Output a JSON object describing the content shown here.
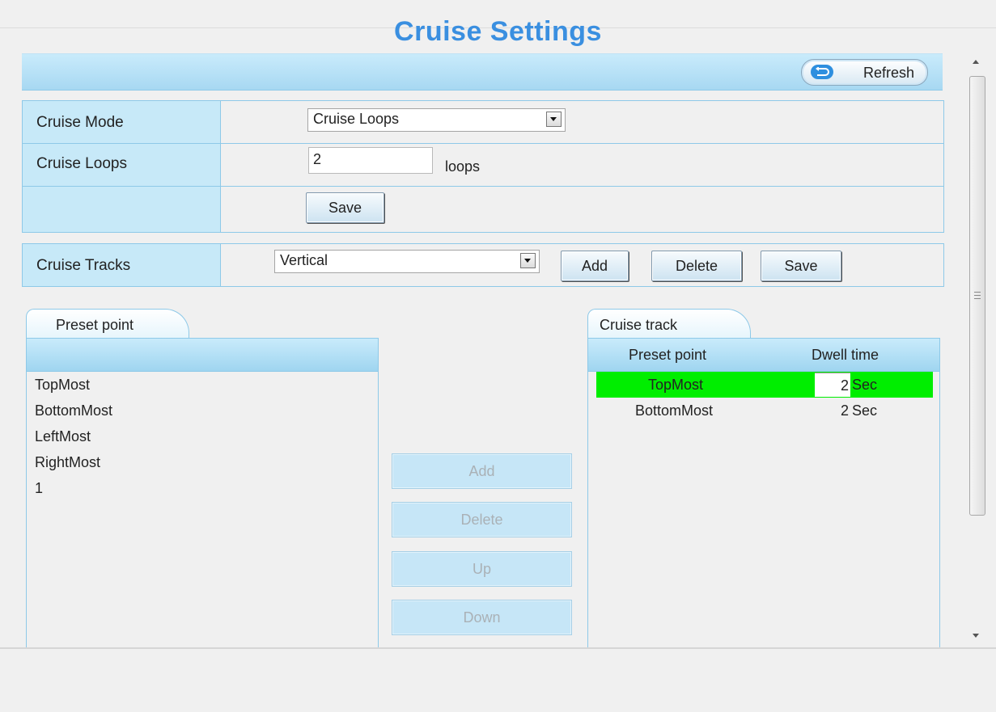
{
  "page": {
    "title": "Cruise Settings"
  },
  "toolbar": {
    "refresh_label": "Refresh"
  },
  "settings": {
    "cruise_mode_label": "Cruise Mode",
    "cruise_mode_value": "Cruise Loops",
    "cruise_loops_label": "Cruise Loops",
    "cruise_loops_value": "2",
    "loops_unit": "loops",
    "save_label": "Save"
  },
  "tracks": {
    "label": "Cruise Tracks",
    "selected": "Vertical",
    "add_label": "Add",
    "delete_label": "Delete",
    "save_label": "Save"
  },
  "preset_panel": {
    "tab_label": "Preset point",
    "items": [
      "TopMost",
      "BottomMost",
      "LeftMost",
      "RightMost",
      "1"
    ]
  },
  "actions": {
    "add": "Add",
    "delete": "Delete",
    "up": "Up",
    "down": "Down"
  },
  "track_panel": {
    "tab_label": "Cruise track",
    "col_preset": "Preset point",
    "col_dwell": "Dwell time",
    "rows": [
      {
        "preset": "TopMost",
        "dwell": "2",
        "unit": "Sec",
        "selected": true
      },
      {
        "preset": "BottomMost",
        "dwell": "2",
        "unit": "Sec",
        "selected": false
      }
    ]
  },
  "colors": {
    "title": "#3a8fe0",
    "selected_row": "#00ee00",
    "header_bg": "#c7e9f8"
  }
}
